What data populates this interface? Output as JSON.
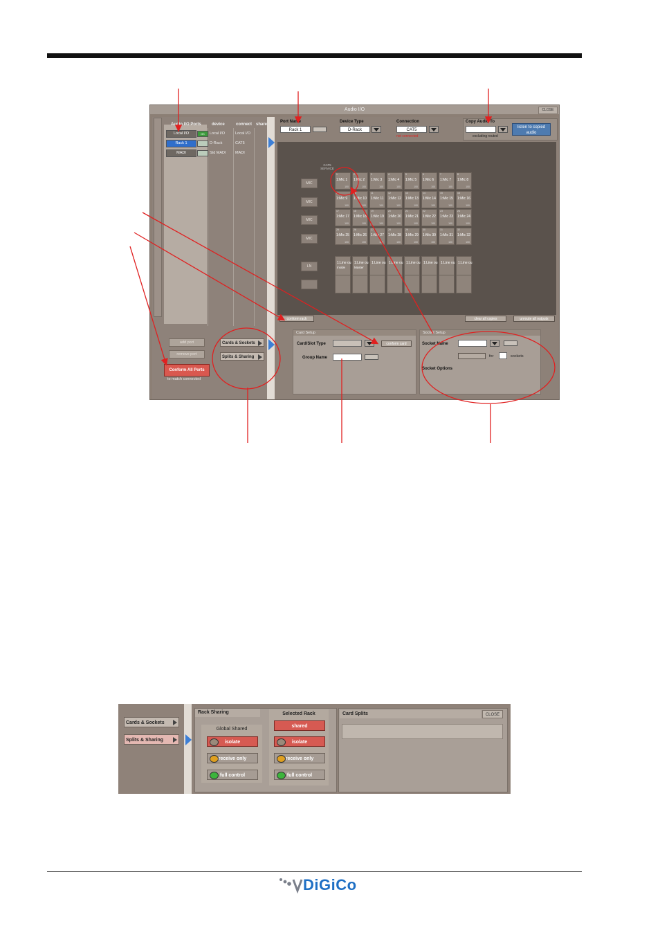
{
  "window": {
    "title": "Audio I/O",
    "close_label": "CLOSE"
  },
  "ports": {
    "headers": [
      "Audio I/O Ports",
      "device",
      "connect",
      "share"
    ],
    "rows": [
      {
        "name": "Local I/O",
        "status": "OK",
        "device": "Local I/O",
        "connect": "Local I/O"
      },
      {
        "name": "Rack 1",
        "status": "",
        "device": "D-Rack",
        "connect": "CAT5"
      },
      {
        "name": "MADI",
        "status": "",
        "device": "Std MADI",
        "connect": "MADI"
      }
    ],
    "add_port": "add port",
    "remove_port": "remove port",
    "conform_all": "Conform All Ports",
    "conform_sub": "to match connected"
  },
  "nav": {
    "cards_sockets": "Cards & Sockets",
    "splits_sharing": "Splits & Sharing"
  },
  "header": {
    "port_name_label": "Port Name",
    "port_name_value": "Rack 1",
    "device_type_label": "Device Type",
    "device_type_value": "D-Rack",
    "connection_label": "Connection",
    "connection_value": "CAT5",
    "connection_status": "not connected",
    "copy_audio_label": "Copy Audio To",
    "copy_audio_sub": "excluding routed",
    "listen_btn": "listen to copied audio"
  },
  "grid": {
    "cat5_label": "CAT5 SERVICE",
    "row_labels": [
      "MIC",
      "MIC",
      "MIC",
      "MIC",
      "LN",
      ""
    ],
    "mic_cells": [
      [
        "1:Mic 1",
        "1:Mic 2",
        "1:Mic 3",
        "1:Mic 4",
        "1:Mic 5",
        "1:Mic 6",
        "1:Mic 7",
        "1:Mic 8"
      ],
      [
        "1:Mic 9",
        "1:Mic 10",
        "1:Mic 11",
        "1:Mic 12",
        "1:Mic 13",
        "1:Mic 14",
        "1:Mic 15",
        "1:Mic 16"
      ],
      [
        "1:Mic 17",
        "1:Mic 18",
        "1:Mic 19",
        "1:Mic 20",
        "1:Mic 21",
        "1:Mic 22",
        "1:Mic 23",
        "1:Mic 24"
      ],
      [
        "1:Mic 25",
        "1:Mic 26",
        "1:Mic 27",
        "1:Mic 28",
        "1:Mic 29",
        "1:Mic 30",
        "1:Mic 31",
        "1:Mic 32"
      ]
    ],
    "level": "100",
    "line_cells": [
      "1:Line ou",
      "1:Line ou",
      "1:Line ou",
      "1:Line ou",
      "1:Line ou",
      "1:Line ou",
      "1:Line ou",
      "1:Line ou"
    ],
    "line_subs": [
      "Inside",
      "Master",
      "",
      "",
      "",
      "",
      "",
      ""
    ],
    "conform_rack": "conform rack",
    "clear_copies": "clear all copies",
    "unroute_outputs": "unroute all outputs"
  },
  "card_setup": {
    "title": "Card Setup",
    "slot_type_label": "Card/Slot Type",
    "conform_card": "conform card",
    "group_name_label": "Group Name"
  },
  "socket_setup": {
    "title": "Socket Setup",
    "socket_name_label": "Socket Name",
    "for_label": "for",
    "sockets_label": "sockets",
    "socket_options": "Socket Options"
  },
  "sharing": {
    "nav_cards": "Cards & Sockets",
    "nav_splits": "Splits & Sharing",
    "rack_sharing_title": "Rack Sharing",
    "global_shared": "Global Shared",
    "selected_rack": "Selected Rack",
    "shared": "shared",
    "isolate": "isolate",
    "receive_only": "receive only",
    "full_control": "full control",
    "card_splits": "Card Splits",
    "close": "CLOSE"
  },
  "logo": {
    "text": "DiGiCo"
  },
  "colors": {
    "accent_red": "#d9584f",
    "select_blue": "#2f6ecb",
    "arrow_red": "#e02020"
  }
}
